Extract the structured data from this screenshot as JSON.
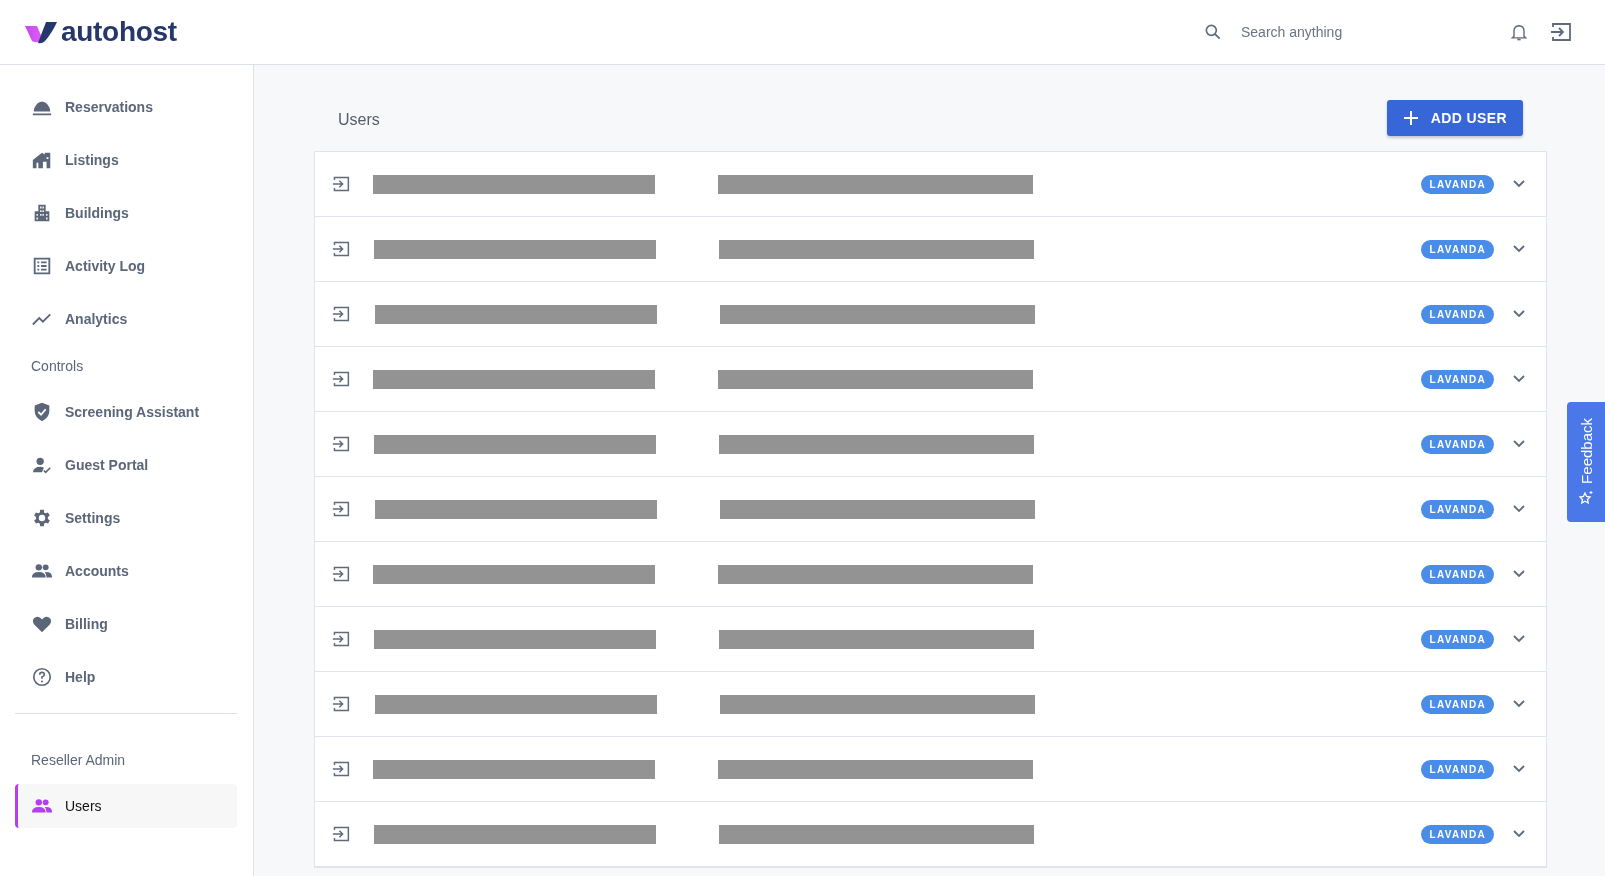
{
  "logo": {
    "text": "autohost"
  },
  "search": {
    "placeholder": "Search anything"
  },
  "sidebar": {
    "items": [
      {
        "label": "Reservations",
        "kind": "item",
        "selected": false
      },
      {
        "label": "Listings",
        "kind": "item",
        "selected": false
      },
      {
        "label": "Buildings",
        "kind": "item",
        "selected": false
      },
      {
        "label": "Activity Log",
        "kind": "item",
        "selected": false
      },
      {
        "label": "Analytics",
        "kind": "item",
        "selected": false
      },
      {
        "label": "Controls",
        "kind": "heading"
      },
      {
        "label": "Screening Assistant",
        "kind": "item",
        "selected": false
      },
      {
        "label": "Guest Portal",
        "kind": "item",
        "selected": false
      },
      {
        "label": "Settings",
        "kind": "item",
        "selected": false
      },
      {
        "label": "Accounts",
        "kind": "item",
        "selected": false
      },
      {
        "label": "Billing",
        "kind": "item",
        "selected": false
      },
      {
        "label": "Help",
        "kind": "item",
        "selected": false
      },
      {
        "kind": "divider"
      },
      {
        "label": "Reseller Admin",
        "kind": "heading"
      },
      {
        "label": "Users",
        "kind": "item",
        "selected": true
      }
    ]
  },
  "page": {
    "title": "Users",
    "add_button": "ADD USER"
  },
  "users": [
    {
      "badge": "LAVANDA"
    },
    {
      "badge": "LAVANDA"
    },
    {
      "badge": "LAVANDA"
    },
    {
      "badge": "LAVANDA"
    },
    {
      "badge": "LAVANDA"
    },
    {
      "badge": "LAVANDA"
    },
    {
      "badge": "LAVANDA"
    },
    {
      "badge": "LAVANDA"
    },
    {
      "badge": "LAVANDA"
    },
    {
      "badge": "LAVANDA"
    },
    {
      "badge": "LAVANDA"
    }
  ],
  "feedback": {
    "label": "Feedback"
  }
}
